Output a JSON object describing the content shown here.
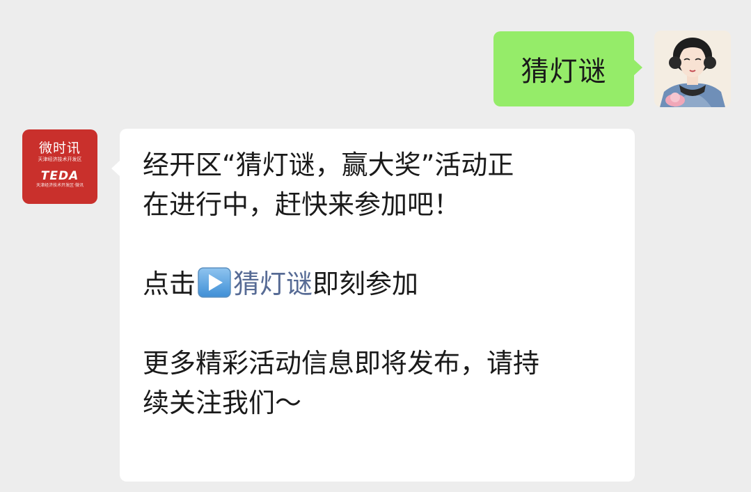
{
  "outgoing": {
    "text": "猜灯谜",
    "bubble_color": "#95ec69"
  },
  "incoming": {
    "avatar": {
      "title": "微时讯",
      "subtitle": "天津经济技术开发区",
      "brand": "TEDA",
      "brand_sub": "天津经济技术开发区·微讯",
      "bg_color": "#c9302c"
    },
    "message": {
      "line1": "经开区“猜灯谜，赢大奖”活动正",
      "line2": "在进行中，赶快来参加吧！",
      "click_prefix": "点击",
      "play_icon": "play-button-icon",
      "link_text": "猜灯谜",
      "click_suffix": "即刻参加",
      "line4": "更多精彩活动信息即将发布，请持",
      "line5": "续关注我们～"
    },
    "link_color": "#576b95"
  },
  "background_color": "#ededed"
}
